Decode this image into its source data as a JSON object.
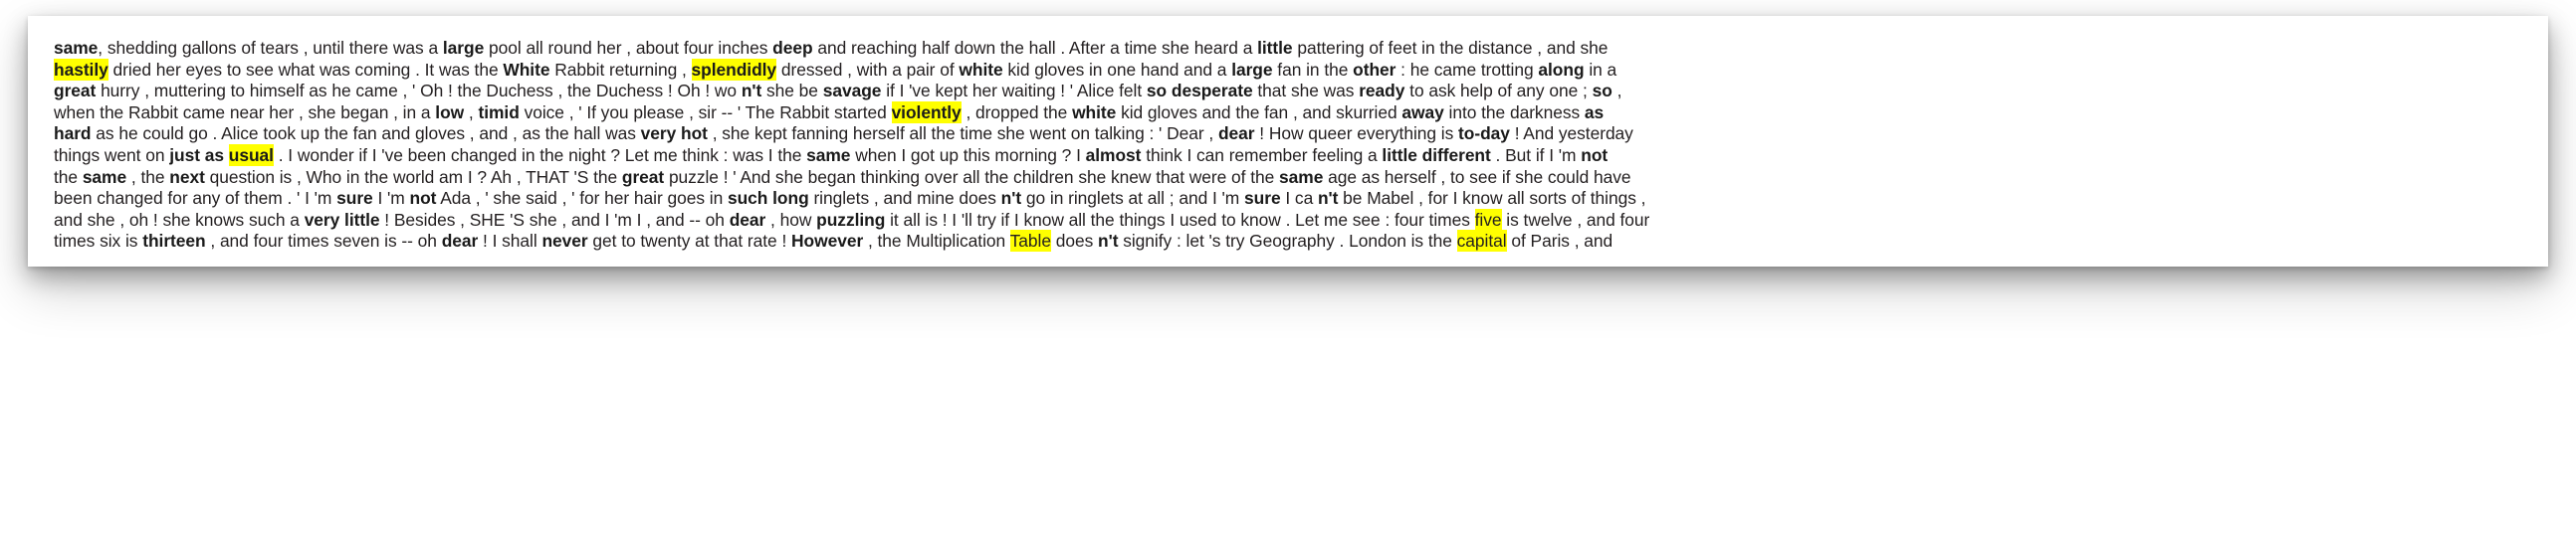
{
  "document": {
    "title_visible": false,
    "highlight_color": "#ffff00",
    "text_color": "#231f20",
    "background_color": "#ffffff",
    "lines": [
      {
        "id": "line-1",
        "tokens": [
          {
            "t": "same",
            "bold": true
          },
          {
            "t": ", shedding gallons of tears , until there was a "
          },
          {
            "t": "large",
            "bold": true
          },
          {
            "t": " pool all round her , about four inches "
          },
          {
            "t": "deep",
            "bold": true
          },
          {
            "t": " and reaching half down the hall . After a time she heard a "
          },
          {
            "t": "little",
            "bold": true
          },
          {
            "t": " pattering of feet in the distance , and she"
          }
        ]
      },
      {
        "id": "line-2",
        "tokens": [
          {
            "t": "hastily",
            "bold": true,
            "highlight": true
          },
          {
            "t": " dried her eyes to see what was coming . It was the "
          },
          {
            "t": "White",
            "bold": true
          },
          {
            "t": " Rabbit returning , "
          },
          {
            "t": "splendidly",
            "bold": true,
            "highlight": true
          },
          {
            "t": " dressed , with a pair of "
          },
          {
            "t": "white",
            "bold": true
          },
          {
            "t": " kid gloves in one hand and a "
          },
          {
            "t": "large",
            "bold": true
          },
          {
            "t": " fan in the "
          },
          {
            "t": "other",
            "bold": true
          },
          {
            "t": " : he came trotting "
          },
          {
            "t": "along",
            "bold": true
          },
          {
            "t": " in a"
          }
        ]
      },
      {
        "id": "line-3",
        "tokens": [
          {
            "t": "great",
            "bold": true
          },
          {
            "t": " hurry , muttering to himself as he came , ' Oh ! the Duchess , the Duchess ! Oh ! wo "
          },
          {
            "t": "n't",
            "bold": true
          },
          {
            "t": " she be "
          },
          {
            "t": "savage",
            "bold": true
          },
          {
            "t": " if I 've kept her waiting ! ' Alice felt "
          },
          {
            "t": "so desperate",
            "bold": true
          },
          {
            "t": " that she was "
          },
          {
            "t": "ready",
            "bold": true
          },
          {
            "t": " to ask help of any one ; "
          },
          {
            "t": "so",
            "bold": true
          },
          {
            "t": " ,"
          }
        ]
      },
      {
        "id": "line-4",
        "tokens": [
          {
            "t": "when the Rabbit came near her , she began , in a "
          },
          {
            "t": "low",
            "bold": true
          },
          {
            "t": " , "
          },
          {
            "t": "timid",
            "bold": true
          },
          {
            "t": " voice , ' If you please , sir -- ' The Rabbit started "
          },
          {
            "t": "violently",
            "bold": true,
            "highlight": true
          },
          {
            "t": " , dropped the "
          },
          {
            "t": "white",
            "bold": true
          },
          {
            "t": " kid gloves and the fan , and skurried "
          },
          {
            "t": "away",
            "bold": true
          },
          {
            "t": " into the darkness "
          },
          {
            "t": "as",
            "bold": true
          }
        ]
      },
      {
        "id": "line-5",
        "tokens": [
          {
            "t": "hard",
            "bold": true
          },
          {
            "t": " as he could go . Alice took up the fan and gloves , and , as the hall was "
          },
          {
            "t": "very hot",
            "bold": true
          },
          {
            "t": " , she kept fanning herself all the time she went on talking : ' Dear , "
          },
          {
            "t": "dear",
            "bold": true
          },
          {
            "t": " ! How queer everything is "
          },
          {
            "t": "to-day",
            "bold": true
          },
          {
            "t": " ! And yesterday"
          }
        ]
      },
      {
        "id": "line-6",
        "tokens": [
          {
            "t": "things went on "
          },
          {
            "t": "just as ",
            "bold": true
          },
          {
            "t": "usual",
            "bold": true,
            "highlight": true
          },
          {
            "t": " . I wonder if I 've been changed in the night ? Let me think : was I the "
          },
          {
            "t": "same",
            "bold": true
          },
          {
            "t": " when I got up this morning ? I "
          },
          {
            "t": "almost",
            "bold": true
          },
          {
            "t": " think I can remember feeling a "
          },
          {
            "t": "little different",
            "bold": true
          },
          {
            "t": " . But if I 'm "
          },
          {
            "t": "not",
            "bold": true
          }
        ]
      },
      {
        "id": "line-7",
        "tokens": [
          {
            "t": "the "
          },
          {
            "t": "same",
            "bold": true
          },
          {
            "t": " , the "
          },
          {
            "t": "next",
            "bold": true
          },
          {
            "t": " question is , Who in the world am I ? Ah , THAT 'S the "
          },
          {
            "t": "great",
            "bold": true
          },
          {
            "t": " puzzle ! ' And she began thinking over all the children she knew that were of the "
          },
          {
            "t": "same",
            "bold": true
          },
          {
            "t": " age as herself , to see if she could have"
          }
        ]
      },
      {
        "id": "line-8",
        "tokens": [
          {
            "t": "been changed for any of them . ' I 'm "
          },
          {
            "t": "sure",
            "bold": true
          },
          {
            "t": " I 'm "
          },
          {
            "t": "not",
            "bold": true
          },
          {
            "t": " Ada , ' she said , ' for her hair goes in "
          },
          {
            "t": "such long",
            "bold": true
          },
          {
            "t": " ringlets , and mine does "
          },
          {
            "t": "n't",
            "bold": true
          },
          {
            "t": " go in ringlets at all ; and I 'm "
          },
          {
            "t": "sure",
            "bold": true
          },
          {
            "t": " I ca "
          },
          {
            "t": "n't",
            "bold": true
          },
          {
            "t": " be Mabel , for I know all sorts of things ,"
          }
        ]
      },
      {
        "id": "line-9",
        "tokens": [
          {
            "t": "and she , oh ! she knows such a "
          },
          {
            "t": "very little",
            "bold": true
          },
          {
            "t": " ! Besides , SHE 'S she , and I 'm I , and -- oh "
          },
          {
            "t": "dear",
            "bold": true
          },
          {
            "t": " , how "
          },
          {
            "t": "puzzling",
            "bold": true
          },
          {
            "t": " it all is ! I 'll try if I know all the things I used to know . Let me see : four times "
          },
          {
            "t": "five",
            "highlight": true
          },
          {
            "t": " is twelve , and four"
          }
        ]
      },
      {
        "id": "line-10",
        "tokens": [
          {
            "t": "times six is "
          },
          {
            "t": "thirteen",
            "bold": true
          },
          {
            "t": " , and four times seven is -- oh "
          },
          {
            "t": "dear",
            "bold": true
          },
          {
            "t": " ! I shall "
          },
          {
            "t": "never",
            "bold": true
          },
          {
            "t": " get to twenty at that rate ! "
          },
          {
            "t": "However",
            "bold": true
          },
          {
            "t": " , the Multiplication "
          },
          {
            "t": "Table",
            "highlight": true
          },
          {
            "t": " does "
          },
          {
            "t": "n't",
            "bold": true
          },
          {
            "t": " signify : let 's try Geography . London is the "
          },
          {
            "t": "capital",
            "highlight": true
          },
          {
            "t": " of Paris , and"
          }
        ]
      }
    ]
  }
}
